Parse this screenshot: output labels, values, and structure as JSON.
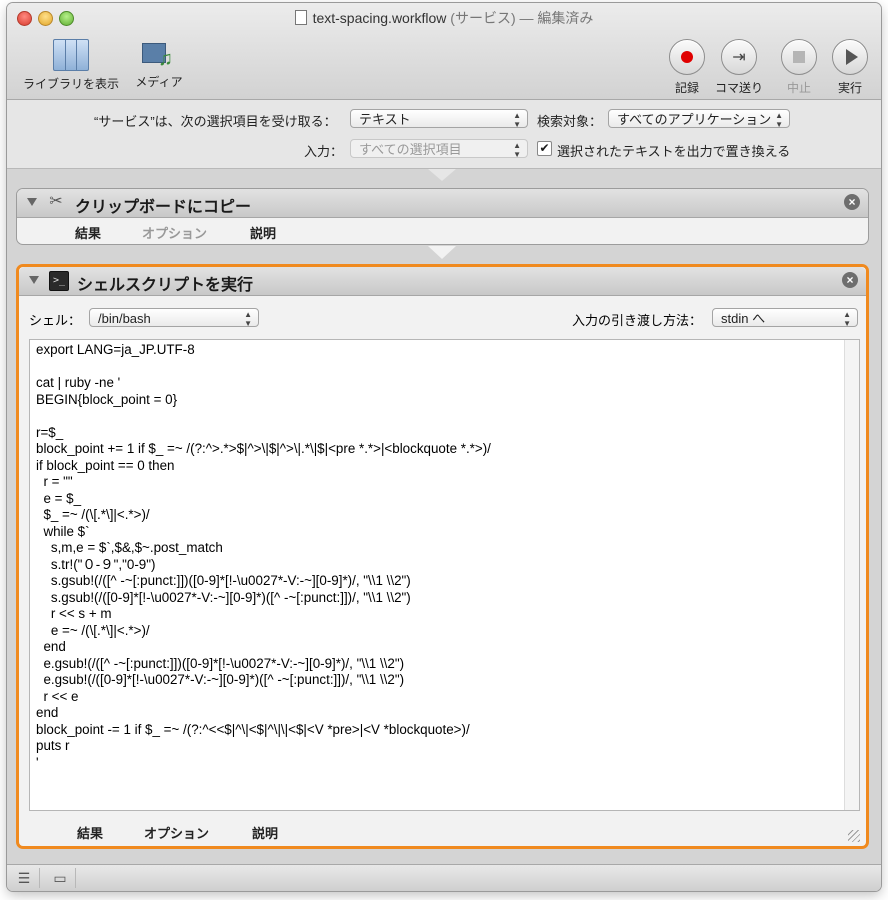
{
  "window": {
    "filename": "text-spacing.workflow",
    "kind": "(サービス)",
    "state": "— 編集済み"
  },
  "toolbar": {
    "library_label": "ライブラリを表示",
    "media_label": "メディア",
    "record_label": "記録",
    "step_label": "コマ送り",
    "stop_label": "中止",
    "run_label": "実行"
  },
  "service_options": {
    "receives_label": "“サービス”は、次の選択項目を受け取る：",
    "receives_value": "テキスト",
    "search_label": "検索対象：",
    "search_value": "すべてのアプリケーション",
    "input_label": "入力：",
    "input_value": "すべての選択項目",
    "replace_label": "選択されたテキストを出力で置き換える",
    "replace_checked": true
  },
  "actions": [
    {
      "title": "クリップボードにコピー",
      "tabs": [
        "結果",
        "オプション",
        "説明"
      ],
      "icon": "tools-icon"
    },
    {
      "title": "シェルスクリプトを実行",
      "icon": "terminal-icon",
      "shell_label": "シェル：",
      "shell_value": "/bin/bash",
      "pass_input_label": "入力の引き渡し方法：",
      "pass_input_value": "stdin へ",
      "script": "export LANG=ja_JP.UTF-8\n\ncat | ruby -ne '\nBEGIN{block_point = 0}\n\nr=$_\nblock_point += 1 if $_ =~ /(?:^>.*>$|^>\\|$|^>\\|.*\\|$|<pre *.*>|<blockquote *.*>)/\nif block_point == 0 then\n  r = \"\"\n  e = $_\n  $_ =~ /(\\[.*\\]|<.*>)/\n  while $`\n    s,m,e = $`,$&,$~.post_match\n    s.tr!(\"０-９\",\"0-9\")\n    s.gsub!(/([^ -~[:punct:]])([0-9]*[!-\\u0027*-V:-~][0-9]*)/, \"\\\\1 \\\\2\")\n    s.gsub!(/([0-9]*[!-\\u0027*-V:-~][0-9]*)([^ -~[:punct:]])/, \"\\\\1 \\\\2\")\n    r << s + m\n    e =~ /(\\[.*\\]|<.*>)/\n  end\n  e.gsub!(/([^ -~[:punct:]])([0-9]*[!-\\u0027*-V:-~][0-9]*)/, \"\\\\1 \\\\2\")\n  e.gsub!(/([0-9]*[!-\\u0027*-V:-~][0-9]*)([^ -~[:punct:]])/, \"\\\\1 \\\\2\")\n  r << e\nend\nblock_point -= 1 if $_ =~ /(?:^<<$|^\\|<$|^\\|\\|<$|<V *pre>|<V *blockquote>)/\nputs r\n'",
      "tabs": [
        "結果",
        "オプション",
        "説明"
      ]
    }
  ]
}
